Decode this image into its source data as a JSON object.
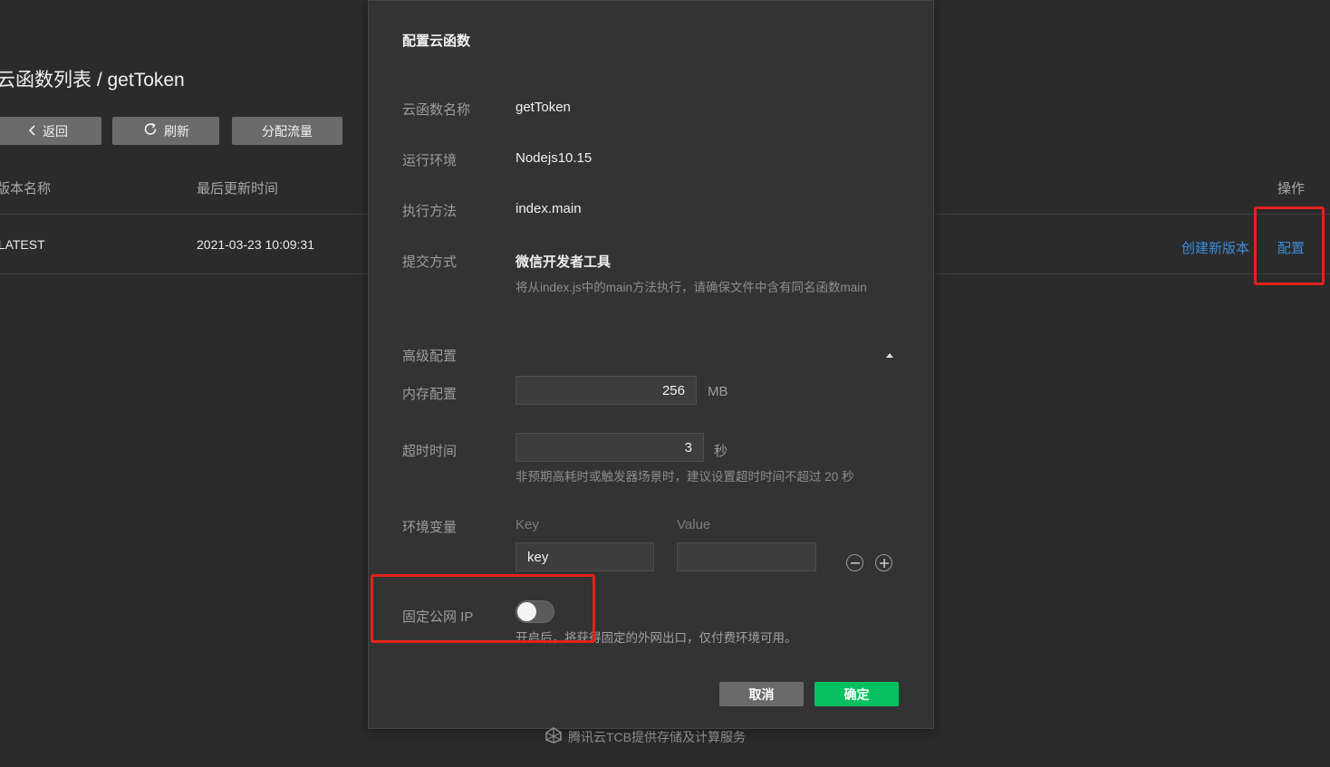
{
  "page": {
    "title": "云函数列表 / getToken",
    "buttons": {
      "back": "返回",
      "refresh": "刷新",
      "traffic": "分配流量"
    },
    "table": {
      "headers": {
        "version_name": "版本名称",
        "updated": "最后更新时间",
        "actions": "操作"
      },
      "row": {
        "version": "$LATEST",
        "time": "2021-03-23 10:09:31",
        "create_link": "创建新版本",
        "config_link": "配置"
      }
    }
  },
  "modal": {
    "title": "配置云函数",
    "fields": {
      "name_label": "云函数名称",
      "name_value": "getToken",
      "runtime_label": "运行环境",
      "runtime_value": "Nodejs10.15",
      "handler_label": "执行方法",
      "handler_value": "index.main",
      "submit_label": "提交方式",
      "submit_value": "微信开发者工具",
      "submit_hint": "将从index.js中的main方法执行，请确保文件中含有同名函数main"
    },
    "advanced": {
      "label": "高级配置",
      "memory_label": "内存配置",
      "memory_value": "256",
      "memory_unit": "MB",
      "timeout_label": "超时时间",
      "timeout_value": "3",
      "timeout_unit": "秒",
      "timeout_hint": "非预期高耗时或触发器场景时，建议设置超时时间不超过 20 秒",
      "env_label": "环境变量",
      "key_header": "Key",
      "value_header": "Value",
      "key_value": "key",
      "value_value": ""
    },
    "fixed_ip": {
      "label": "固定公网 IP",
      "enabled": false,
      "hint": "开启后，将获得固定的外网出口，仅付费环境可用。"
    },
    "actions": {
      "cancel": "取消",
      "confirm": "确定"
    }
  },
  "footer": {
    "text": "腾讯云TCB提供存储及计算服务"
  },
  "colors": {
    "accent": "#07c160",
    "link": "#3b8dd8",
    "highlight": "#e5221c"
  }
}
